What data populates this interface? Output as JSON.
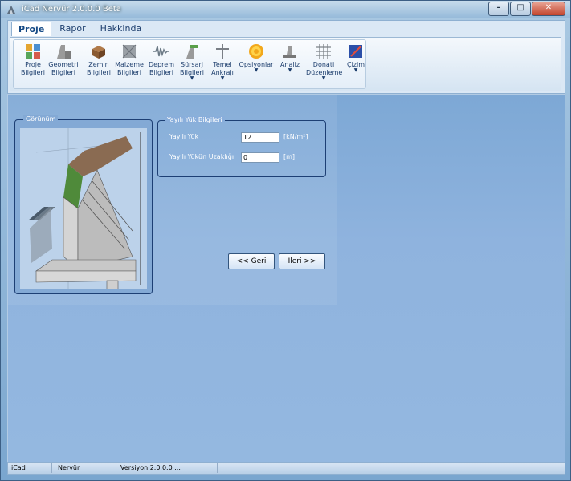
{
  "window": {
    "title": "iCad Nervür 2.0.0.0 Beta"
  },
  "tabs": [
    {
      "label": "Proje",
      "active": true
    },
    {
      "label": "Rapor",
      "active": false
    },
    {
      "label": "Hakkinda",
      "active": false
    }
  ],
  "ribbon": {
    "buttons": [
      {
        "line1": "Proje",
        "line2": "Bilgileri",
        "icon": "project-info-icon"
      },
      {
        "line1": "Geometri",
        "line2": "Bilgileri",
        "icon": "geometry-icon"
      },
      {
        "line1": "Zemin",
        "line2": "Bilgileri",
        "icon": "soil-icon"
      },
      {
        "line1": "Malzeme",
        "line2": "Bilgileri",
        "icon": "material-icon"
      },
      {
        "line1": "Deprem",
        "line2": "Bilgileri",
        "icon": "earthquake-icon"
      },
      {
        "line1": "Sürsarj",
        "line2": "Bilgileri",
        "icon": "surcharge-icon",
        "dropdown": true
      },
      {
        "line1": "Temel",
        "line2": "Ankrajı",
        "icon": "anchor-icon",
        "dropdown": true
      },
      {
        "line1": "Opsiyonlar",
        "line2": "",
        "icon": "gear-icon",
        "dropdown": true
      },
      {
        "line1": "Analiz",
        "line2": "",
        "icon": "analysis-icon",
        "dropdown": true
      },
      {
        "line1": "Donati",
        "line2": "Düzenleme",
        "icon": "rebar-icon",
        "dropdown": true
      },
      {
        "line1": "Çizim",
        "line2": "",
        "icon": "drawing-icon",
        "dropdown": true
      }
    ]
  },
  "view": {
    "title": "Görünüm"
  },
  "load": {
    "title": "Yayılı Yük Bilgileri",
    "load_label": "Yayılı Yük",
    "load_value": "12",
    "load_unit": "[kN/m²]",
    "distance_label": "Yayılı Yükün Uzaklığı",
    "distance_value": "0",
    "distance_unit": "[m]"
  },
  "nav": {
    "back": "<< Geri",
    "next": "İleri >>"
  },
  "status": {
    "app": "iCad",
    "module": "Nervür",
    "version": "Versiyon 2.0.0.0 ..."
  },
  "colors": {
    "accent": "#154a86",
    "content_bg": "#8fb3de"
  }
}
